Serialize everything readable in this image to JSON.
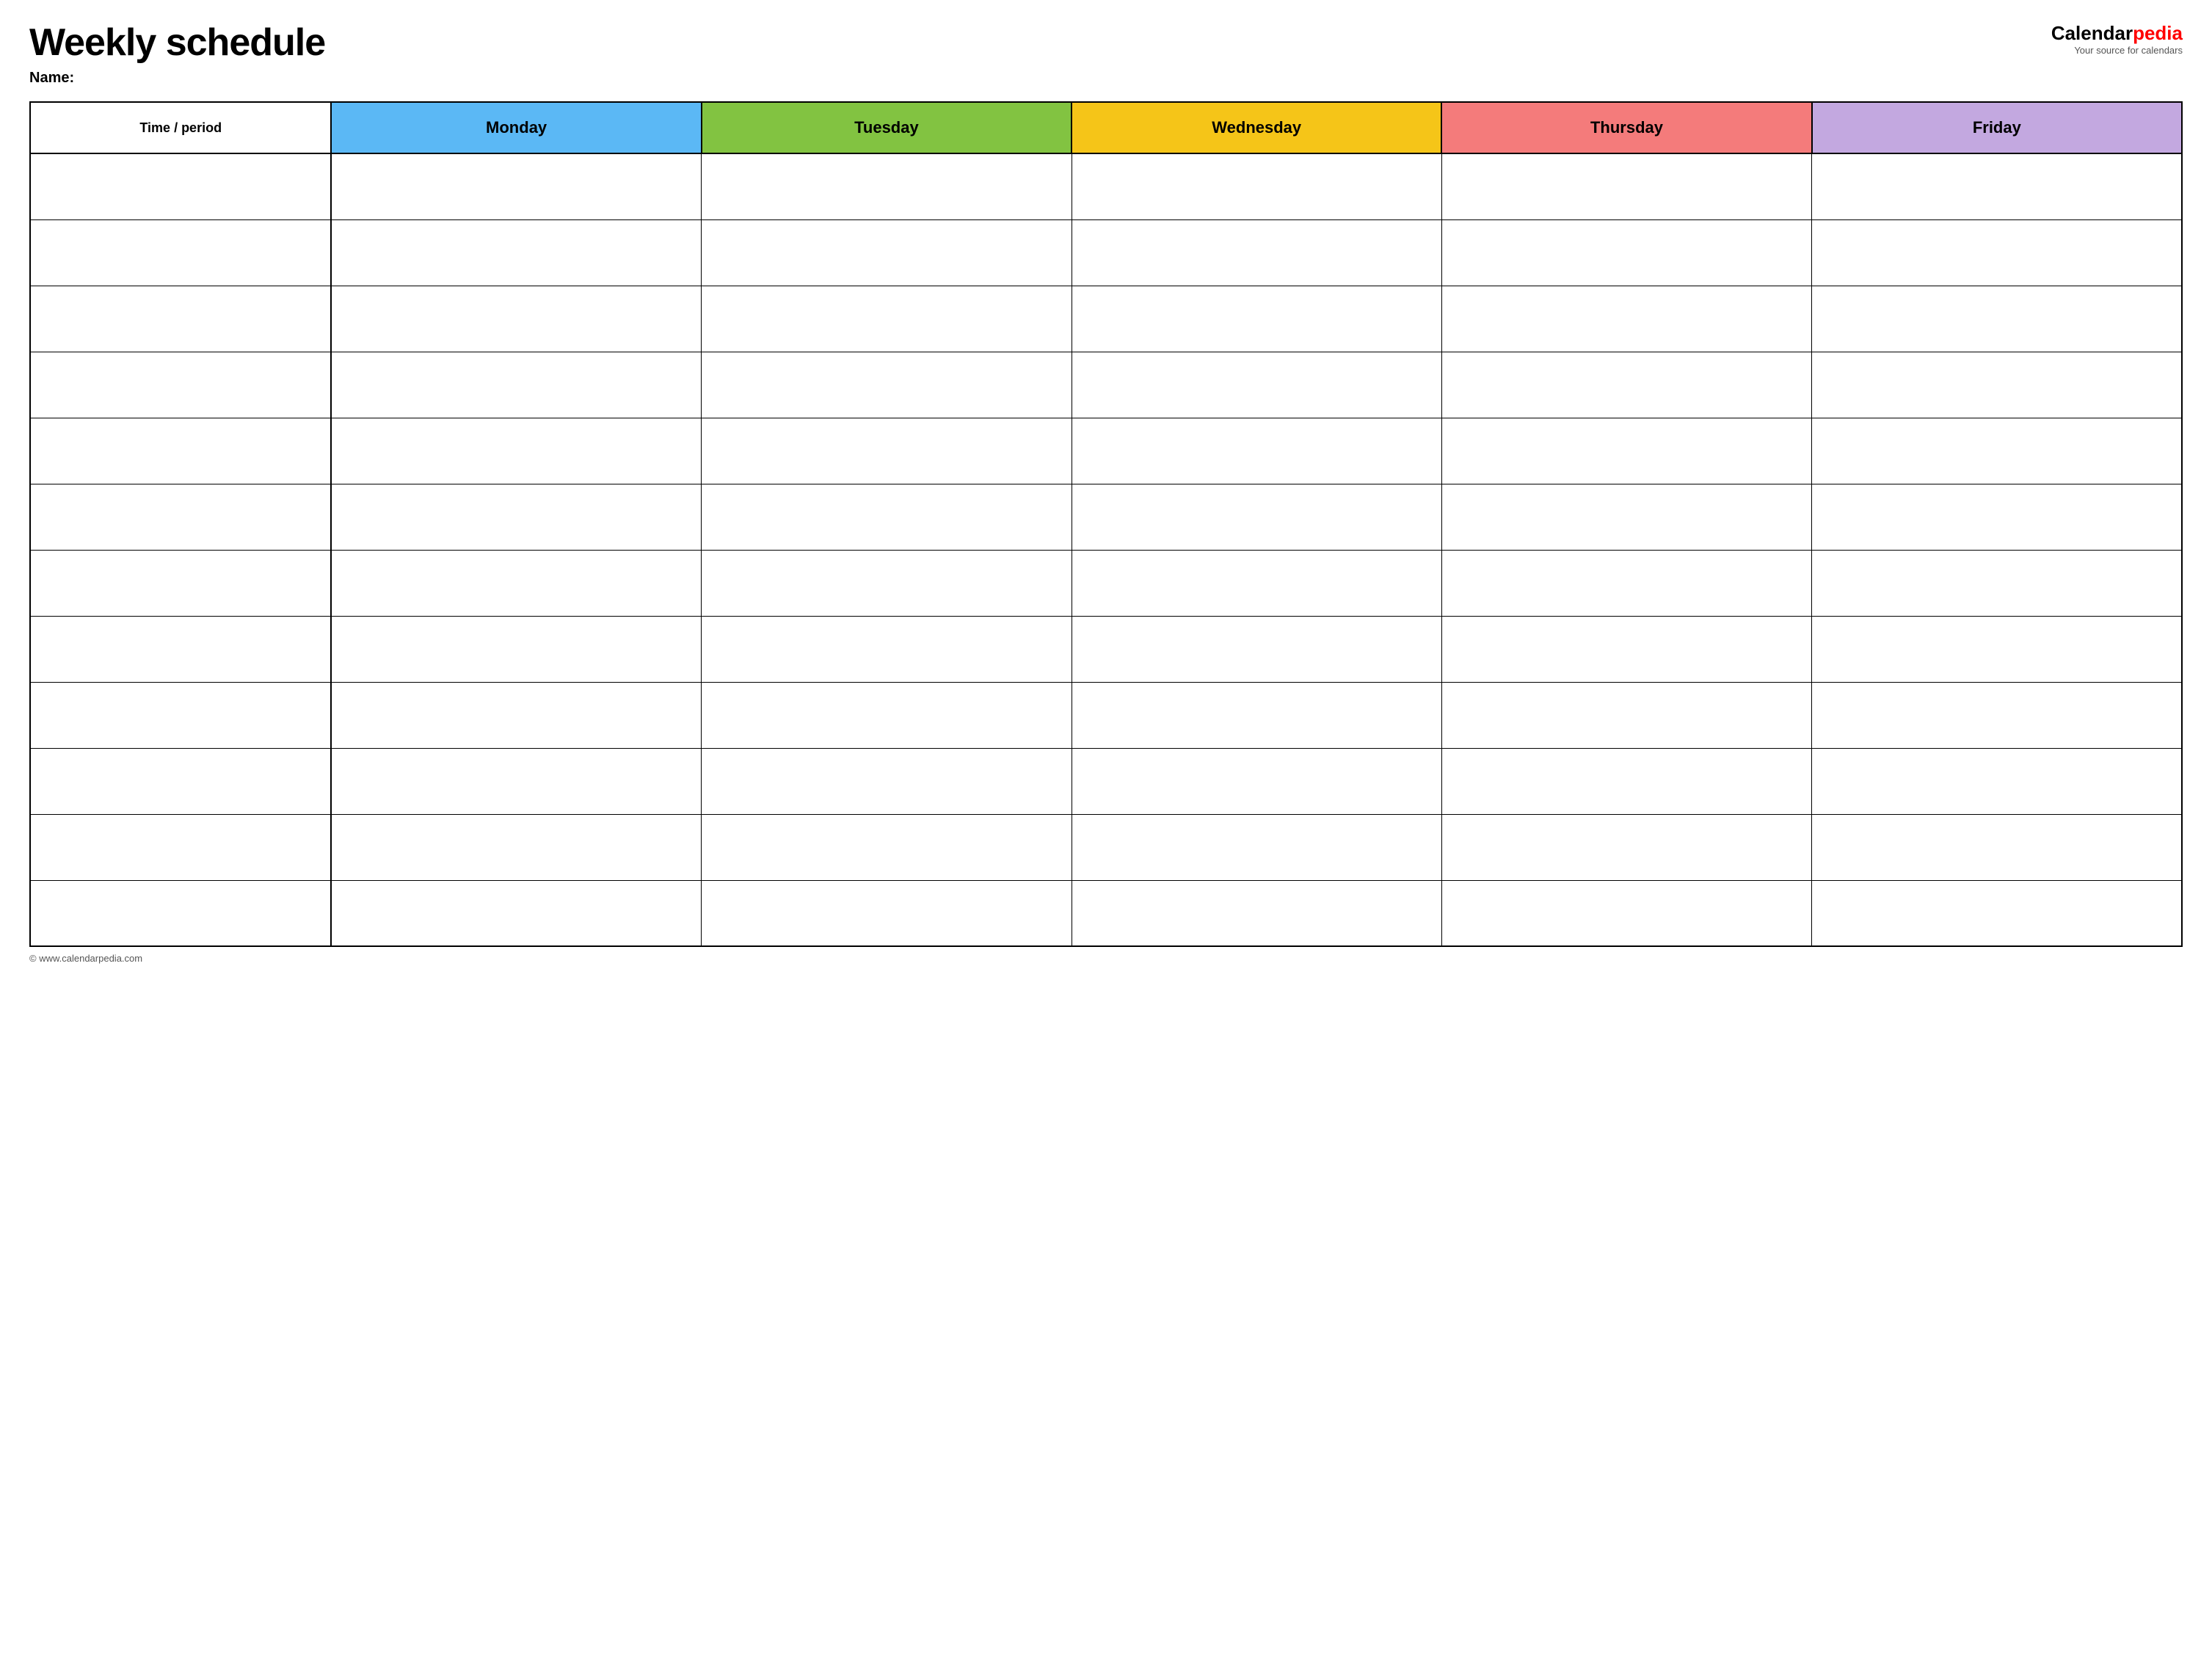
{
  "header": {
    "title": "Weekly schedule",
    "name_label": "Name:",
    "logo": {
      "calendar": "Calendar",
      "pedia": "pedia",
      "tagline": "Your source for calendars"
    }
  },
  "table": {
    "columns": [
      {
        "key": "time",
        "label": "Time / period",
        "color": "#ffffff",
        "class": "th-time"
      },
      {
        "key": "monday",
        "label": "Monday",
        "color": "#5bb8f5",
        "class": "th-monday"
      },
      {
        "key": "tuesday",
        "label": "Tuesday",
        "color": "#82c341",
        "class": "th-tuesday"
      },
      {
        "key": "wednesday",
        "label": "Wednesday",
        "color": "#f5c518",
        "class": "th-wednesday"
      },
      {
        "key": "thursday",
        "label": "Thursday",
        "color": "#f47b7b",
        "class": "th-thursday"
      },
      {
        "key": "friday",
        "label": "Friday",
        "color": "#c3a8e0",
        "class": "th-friday"
      }
    ],
    "row_count": 12
  },
  "footer": {
    "url": "© www.calendarpedia.com"
  }
}
